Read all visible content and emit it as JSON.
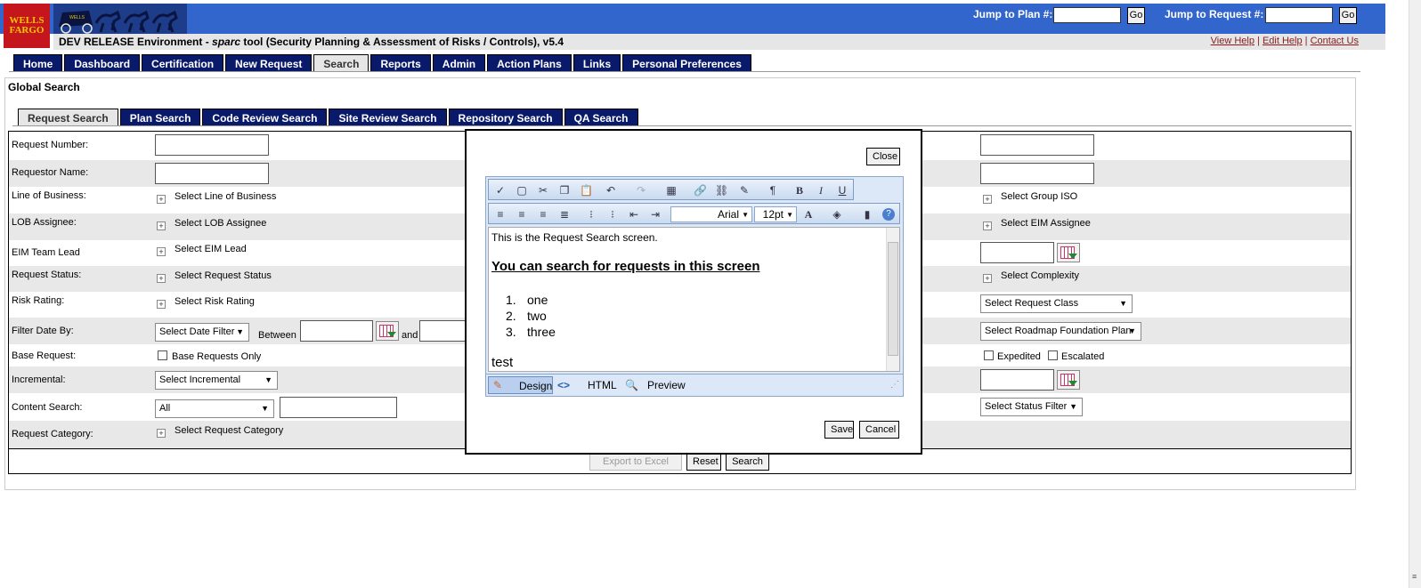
{
  "header": {
    "logo_text": "WELLS FARGO",
    "jump_plan_label": "Jump to Plan #:",
    "jump_request_label": "Jump to Request #:",
    "go_label": "Go",
    "env_title_prefix": "DEV RELEASE Environment - ",
    "env_title_italic": "sparc",
    "env_title_suffix": " tool (Security Planning & Assessment of Risks / Controls), v5.4",
    "help_links": [
      "View Help",
      "Edit Help",
      "Contact Us"
    ],
    "brand_color": "#3366cc",
    "logo_color": "#c4161c"
  },
  "nav": {
    "tabs": [
      "Home",
      "Dashboard",
      "Certification",
      "New Request",
      "Search",
      "Reports",
      "Admin",
      "Action Plans",
      "Links",
      "Personal Preferences"
    ],
    "active": "Search"
  },
  "page": {
    "title": "Global Search",
    "subtabs": [
      "Request Search",
      "Plan Search",
      "Code Review Search",
      "Site Review Search",
      "Repository Search",
      "QA Search"
    ],
    "active_subtab": "Request Search"
  },
  "form": {
    "request_number_label": "Request Number:",
    "requestor_name_label": "Requestor Name:",
    "lob_label": "Line of Business:",
    "lob_link": "Select Line of Business",
    "lob_assignee_label": "LOB Assignee:",
    "lob_assignee_link": "Select LOB Assignee",
    "eim_lead_label": "EIM Team Lead",
    "eim_lead_link": "Select EIM Lead",
    "status_label": "Request Status:",
    "status_link": "Select Request Status",
    "risk_label": "Risk Rating:",
    "risk_link": "Select Risk Rating",
    "filter_label": "Filter Date By:",
    "filter_select": "Select Date Filter",
    "between": "Between",
    "and": "and",
    "base_label": "Base Request:",
    "base_only": "Base Requests Only",
    "incremental_label": "Incremental:",
    "incremental_select": "Select Incremental",
    "content_label": "Content Search:",
    "content_select": "All",
    "category_label": "Request Category:",
    "category_link": "Select Request Category",
    "group_iso_link": "Select Group ISO",
    "eim_assignee_link": "Select EIM Assignee",
    "complexity_link": "Select Complexity",
    "class_select": "Select Request Class",
    "roadmap_select": "Select Roadmap Foundation Plan",
    "expedited": "Expedited",
    "escalated": "Escalated",
    "status_filter_select": "Select Status Filter"
  },
  "actions": {
    "export": "Export to Excel",
    "reset": "Reset",
    "search": "Search"
  },
  "modal": {
    "close": "Close",
    "font_name": "Arial",
    "font_size": "12pt",
    "content": {
      "line1": "This is the Request Search screen.",
      "heading": "You can search for requests in this screen",
      "list": [
        {
          "n": "1.",
          "t": "one"
        },
        {
          "n": "2.",
          "t": "two"
        },
        {
          "n": "3.",
          "t": "three"
        }
      ],
      "last": "test"
    },
    "modes": [
      "Design",
      "HTML",
      "Preview"
    ],
    "active_mode": "Design",
    "save": "Save",
    "cancel": "Cancel"
  }
}
